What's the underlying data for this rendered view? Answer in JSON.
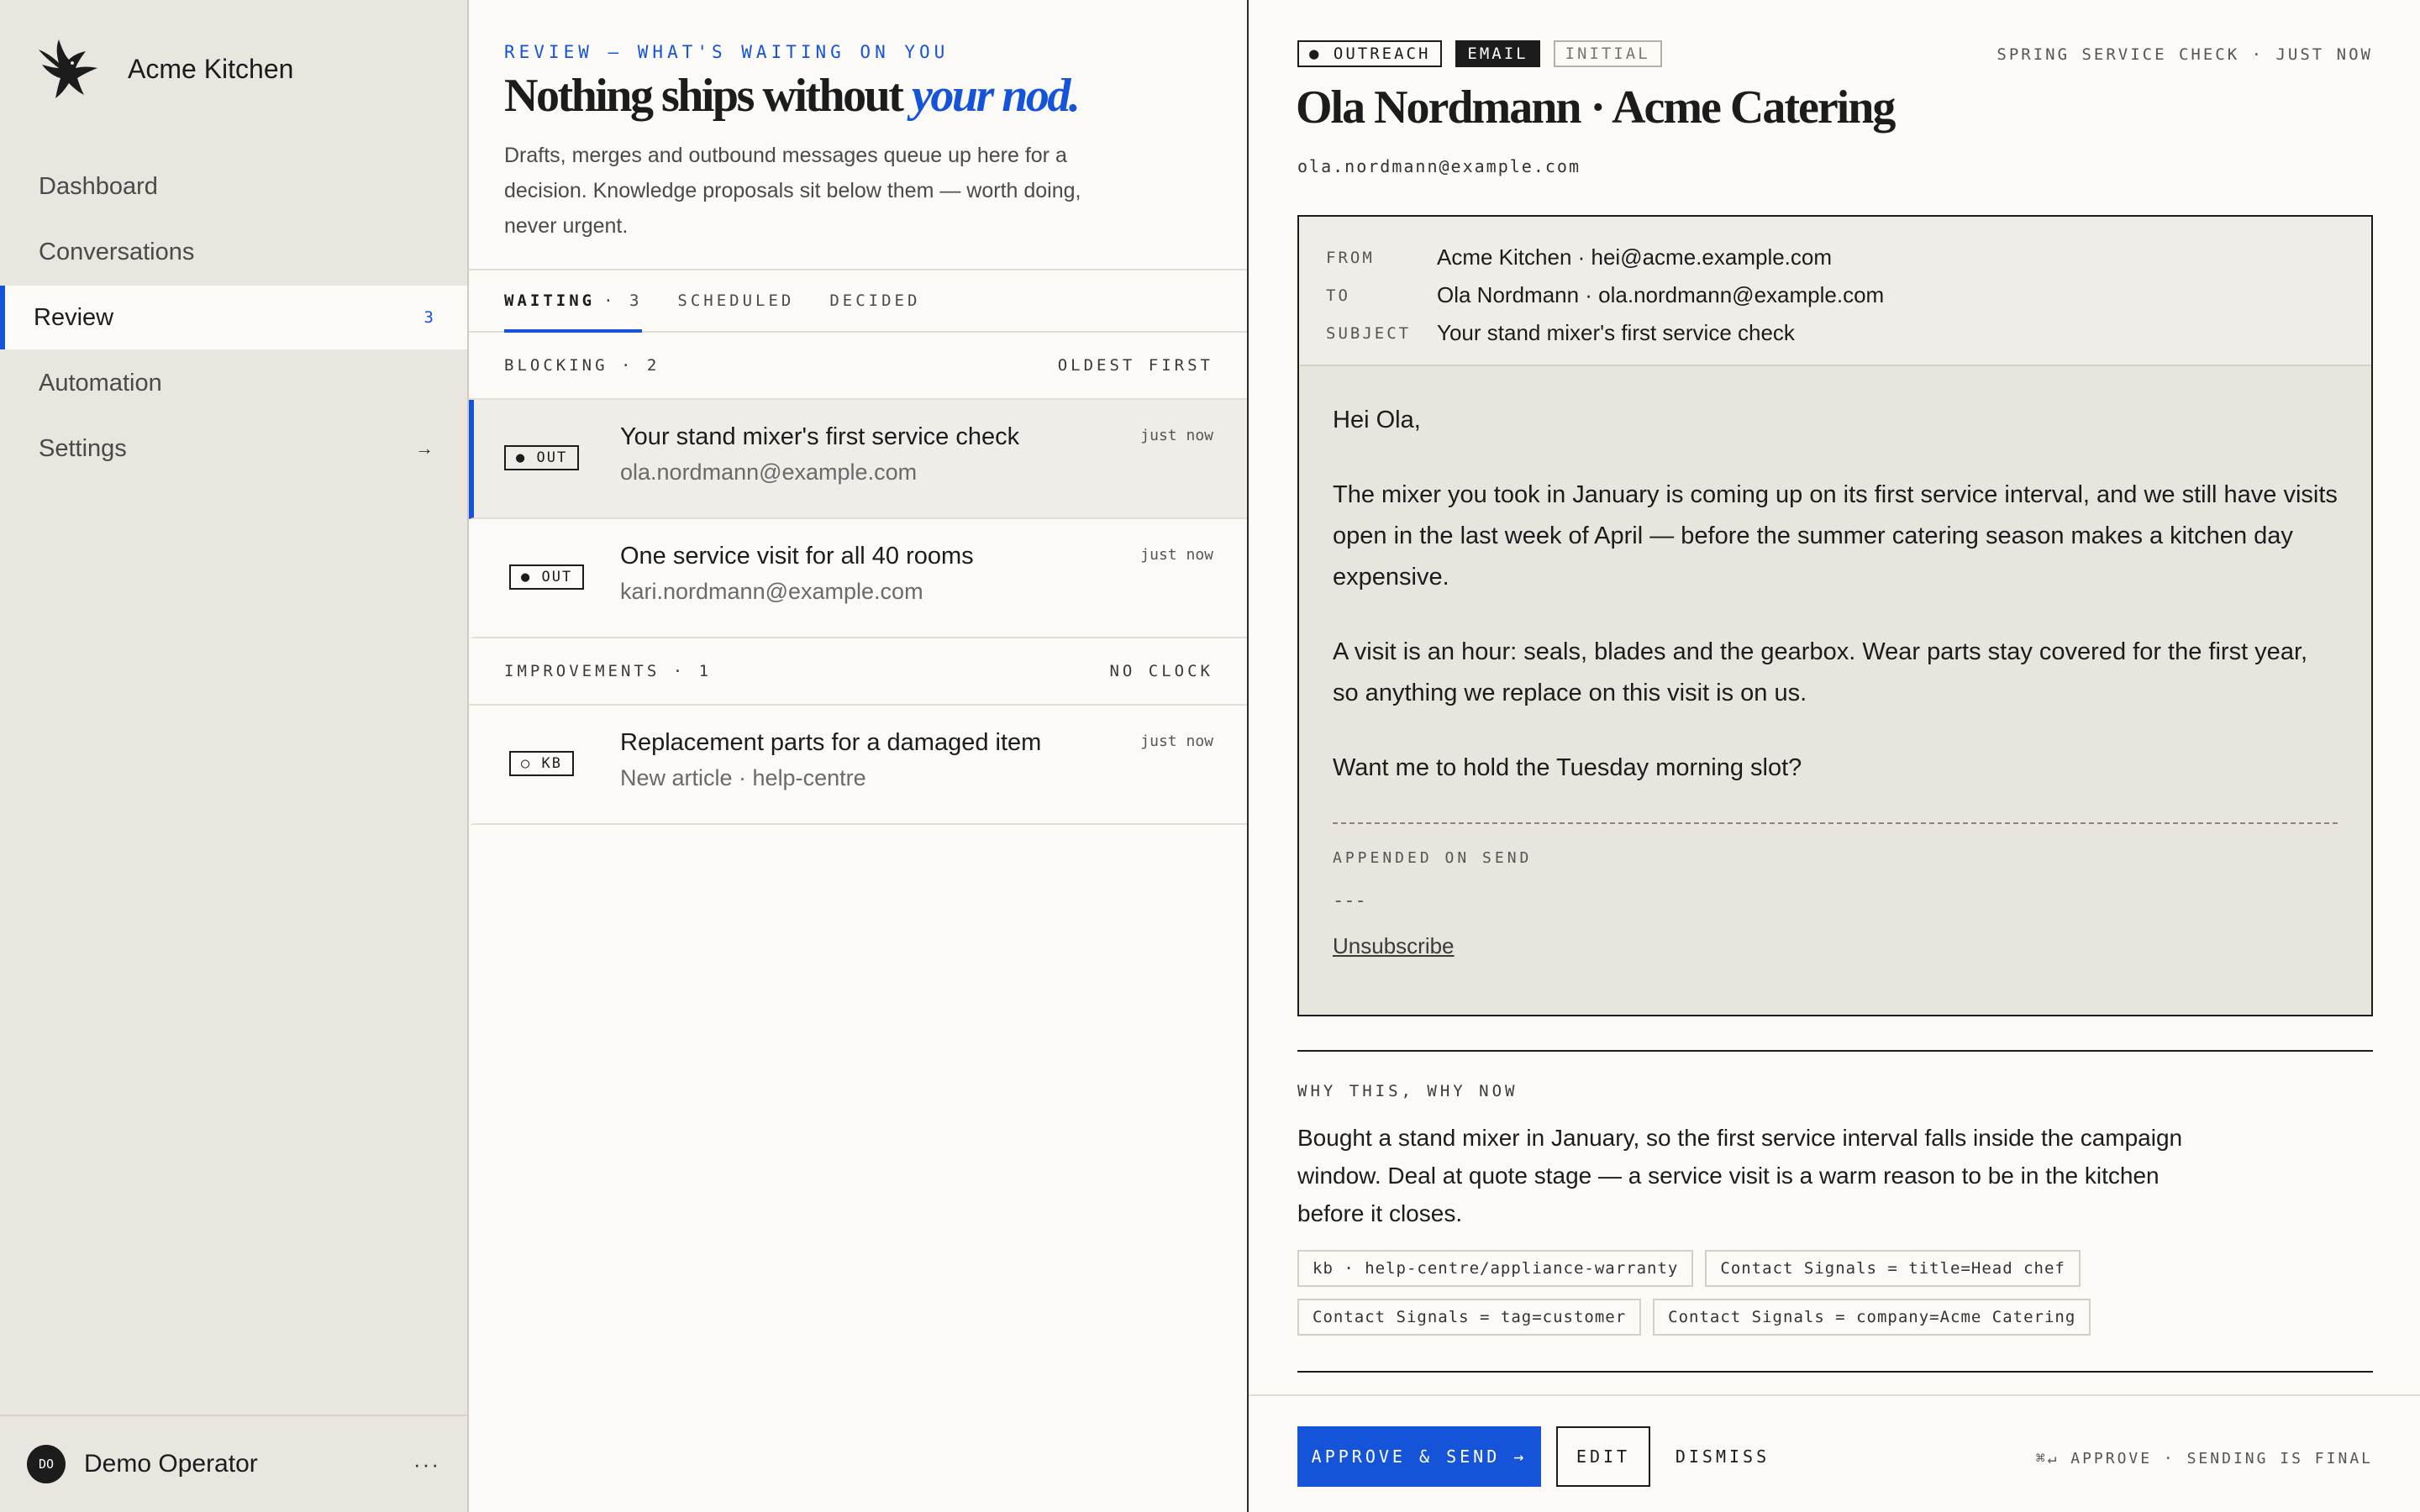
{
  "sidebar": {
    "brand": "Acme Kitchen",
    "nav": [
      {
        "label": "Dashboard"
      },
      {
        "label": "Conversations"
      },
      {
        "label": "Review",
        "badge": "3"
      },
      {
        "label": "Automation"
      },
      {
        "label": "Settings",
        "arrow": "→"
      }
    ],
    "operator": {
      "initials": "DO",
      "name": "Demo Operator",
      "more": "···"
    }
  },
  "queue": {
    "eyebrow": "REVIEW — WHAT'S WAITING ON YOU",
    "title_main": "Nothing ships without ",
    "title_em": "your nod.",
    "description": "Drafts, merges and outbound messages queue up here for a decision. Knowledge proposals sit below them — worth doing, never urgent.",
    "tabs": [
      {
        "label": "WAITING",
        "count": "· 3"
      },
      {
        "label": "SCHEDULED"
      },
      {
        "label": "DECIDED"
      }
    ],
    "groups": [
      {
        "title": "BLOCKING · 2",
        "sort": "OLDEST FIRST",
        "items": [
          {
            "tag": "● OUT",
            "title": "Your stand mixer's first service check",
            "sub": "ola.nordmann@example.com",
            "time": "just now"
          },
          {
            "tag": "● OUT",
            "title": "One service visit for all 40 rooms",
            "sub": "kari.nordmann@example.com",
            "time": "just now"
          }
        ]
      },
      {
        "title": "IMPROVEMENTS · 1",
        "sort": "NO CLOCK",
        "items": [
          {
            "tag": "○ KB",
            "title": "Replacement parts for a damaged item",
            "sub": "New article · help-centre",
            "time": "just now"
          }
        ]
      }
    ]
  },
  "detail": {
    "chips": [
      "● OUTREACH",
      "EMAIL",
      "INITIAL"
    ],
    "meta": "SPRING SERVICE CHECK · JUST NOW",
    "title": "Ola Nordmann · Acme Catering",
    "email": "ola.nordmann@example.com",
    "mail": {
      "from_label": "FROM",
      "from": "Acme Kitchen · hei@acme.example.com",
      "to_label": "TO",
      "to": "Ola Nordmann · ola.nordmann@example.com",
      "subject_label": "SUBJECT",
      "subject": "Your stand mixer's first service check",
      "body": [
        "Hei Ola,",
        "The mixer you took in January is coming up on its first service interval, and we still have visits open in the last week of April — before the summer catering season makes a kitchen day expensive.",
        "A visit is an hour: seals, blades and the gearbox. Wear parts stay covered for the first year, so anything we replace on this visit is on us.",
        "Want me to hold the Tuesday morning slot?"
      ],
      "appended_label": "APPENDED ON SEND",
      "signature_dash": "---",
      "unsubscribe": "Unsubscribe"
    },
    "why": {
      "label": "WHY THIS, WHY NOW",
      "text": "Bought a stand mixer in January, so the first service interval falls inside the campaign window. Deal at quote stage — a service visit is a warm reason to be in the kitchen before it closes.",
      "signals": [
        "kb · help-centre/appliance-warranty",
        "Contact Signals = title=Head chef",
        "Contact Signals = tag=customer",
        "Contact Signals = company=Acme Catering"
      ]
    },
    "actions": {
      "approve": "APPROVE & SEND →",
      "edit": "EDIT",
      "dismiss": "DISMISS",
      "hint": "⌘↵ APPROVE · SENDING IS FINAL"
    }
  },
  "colors": {
    "accent": "#1554d8",
    "sidebar_bg": "#e9e5df",
    "page_bg": "#fbfaf7",
    "mail_bg": "#e8e4de",
    "ink": "#1c1c1c"
  },
  "icons": {
    "brand_logo": "eagle-logo",
    "settings_arrow": "arrow-right-icon",
    "more": "more-horizontal-icon"
  }
}
